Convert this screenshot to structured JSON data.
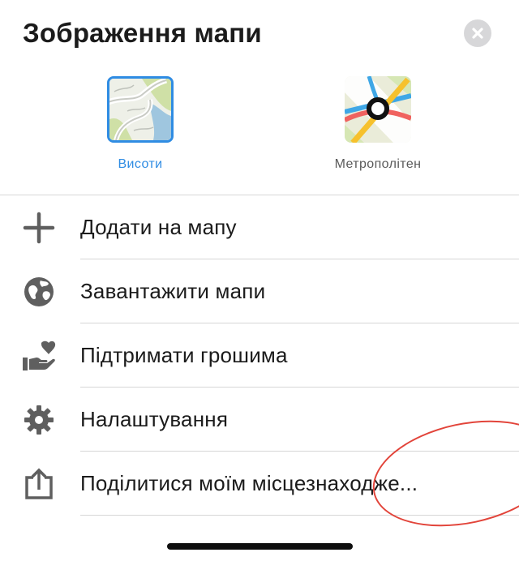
{
  "header": {
    "title": "Зображення мапи",
    "close_icon": "close-x-icon"
  },
  "layers": [
    {
      "label": "Висоти",
      "selected": true,
      "icon": "terrain-map-icon",
      "accent": "#2f8ce3"
    },
    {
      "label": "Метрополітен",
      "selected": false,
      "icon": "subway-map-icon"
    }
  ],
  "menu": {
    "items": [
      {
        "label": "Додати на мапу",
        "icon": "plus-icon"
      },
      {
        "label": "Завантажити мапи",
        "icon": "globe-icon"
      },
      {
        "label": "Підтримати грошима",
        "icon": "donate-heart-hand-icon"
      },
      {
        "label": "Налаштування",
        "icon": "gear-icon"
      },
      {
        "label": "Поділитися моїм місцезнаходже...",
        "icon": "share-icon"
      }
    ]
  },
  "colors": {
    "accent": "#2f8ce3",
    "annotation": "#e2443a",
    "icon_gray": "#5f5f5f"
  }
}
